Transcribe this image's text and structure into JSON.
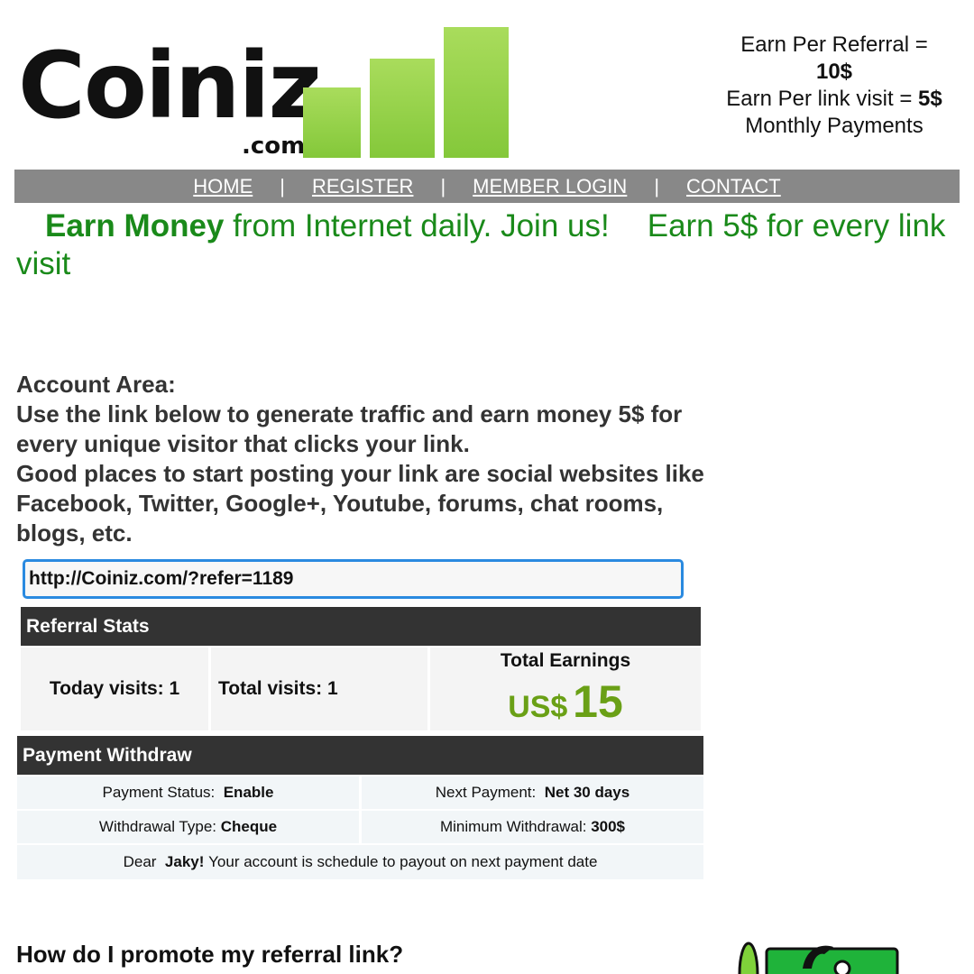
{
  "logo": {
    "word": "Coiniz",
    "tld": ".com"
  },
  "promo": {
    "referral_label": "Earn Per Referral  =",
    "referral_value": "10$",
    "visit_label": "Earn Per link visit = ",
    "visit_value": "5$",
    "payments": "Monthly Payments"
  },
  "nav": {
    "home": "HOME",
    "register": "REGISTER",
    "member_login": "MEMBER LOGIN",
    "contact": "CONTACT",
    "separator": "|"
  },
  "ticker": {
    "bold": "Earn Money",
    "rest": " from Internet daily. Join us!",
    "second": "Earn 5$ for every link visit"
  },
  "account": {
    "heading": "Account Area:",
    "line1": "Use the link below to generate traffic and earn money 5$ for every unique visitor that clicks your link.",
    "line2": "Good places to start posting your link are social websites like Facebook, Twitter, Google+, Youtube, forums, chat rooms, blogs, etc."
  },
  "referral_link": {
    "value": "http://Coiniz.com/?refer=1189"
  },
  "referral_stats": {
    "title": "Referral Stats",
    "today": "Today visits: 1",
    "total": "Total visits: 1",
    "earnings_label": "Total Earnings",
    "currency": "US$",
    "amount": "15"
  },
  "payment": {
    "title": "Payment Withdraw",
    "status_label": "Payment Status:",
    "status_value": "Enable",
    "next_label": "Next Payment:",
    "next_value": "Net 30 days",
    "type_label": "Withdrawal Type:",
    "type_value": "Cheque",
    "min_label": "Minimum Withdrawal:",
    "min_value": "300$",
    "dear": "Dear",
    "name": "Jaky!",
    "message": "Your account is schedule to payout on next payment date"
  },
  "faq": {
    "question": "How do I promote my referral link?"
  },
  "colors": {
    "brand_green": "#84c83a",
    "ticker_green": "#1a8a1a",
    "earnings_green": "#6aa016",
    "nav_gray": "#888888",
    "header_dark": "#333333",
    "input_border": "#2a8ae0"
  }
}
